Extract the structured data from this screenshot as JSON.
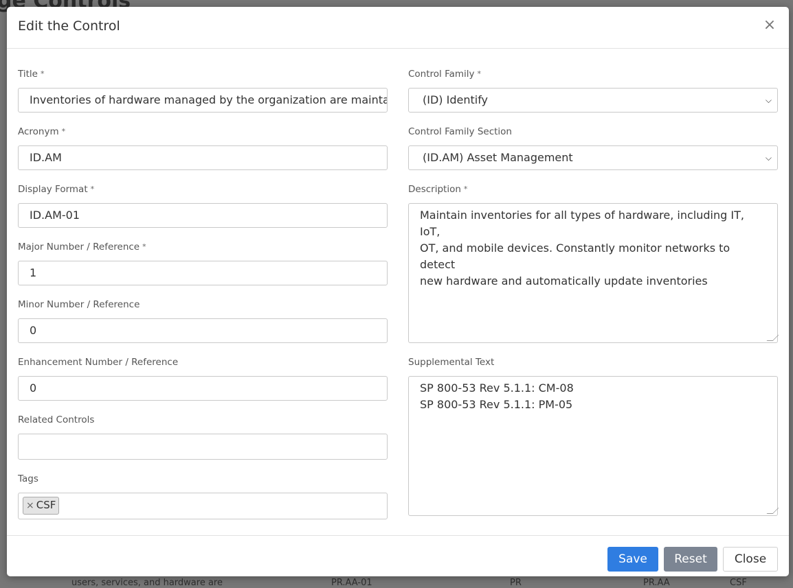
{
  "background": {
    "page_title": "ge Controls",
    "bottom_row": [
      "users, services, and hardware are",
      "PR.AA-01",
      "PR",
      "PR.AA",
      "CSF"
    ]
  },
  "modal": {
    "title": "Edit the Control",
    "close_symbol": "×",
    "left": {
      "title": {
        "label": "Title",
        "value": "Inventories of hardware managed by the organization are maintained"
      },
      "acronym": {
        "label": "Acronym",
        "value": "ID.AM"
      },
      "display_format": {
        "label": "Display Format",
        "value": "ID.AM-01"
      },
      "major": {
        "label": "Major Number / Reference",
        "value": "1"
      },
      "minor": {
        "label": "Minor Number / Reference",
        "value": "0"
      },
      "enhancement": {
        "label": "Enhancement Number / Reference",
        "value": "0"
      },
      "related": {
        "label": "Related Controls",
        "value": ""
      },
      "tags": {
        "label": "Tags",
        "items": [
          "CSF"
        ],
        "remove_symbol": "×"
      }
    },
    "right": {
      "control_family": {
        "label": "Control Family",
        "selected": "(ID) Identify"
      },
      "control_family_section": {
        "label": "Control Family Section",
        "selected": "(ID.AM) Asset Management"
      },
      "description": {
        "label": "Description",
        "lines": [
          "Maintain inventories for all types of hardware, including IT, IoT,",
          "OT, and mobile devices. Constantly monitor networks to detect",
          "new hardware and automatically update inventories"
        ]
      },
      "supplemental": {
        "label": "Supplemental Text",
        "lines": [
          "SP 800-53 Rev 5.1.1: CM-08",
          "SP 800-53 Rev 5.1.1: PM-05"
        ]
      }
    },
    "required_mark": "*",
    "footer": {
      "save": "Save",
      "reset": "Reset",
      "close": "Close"
    }
  }
}
